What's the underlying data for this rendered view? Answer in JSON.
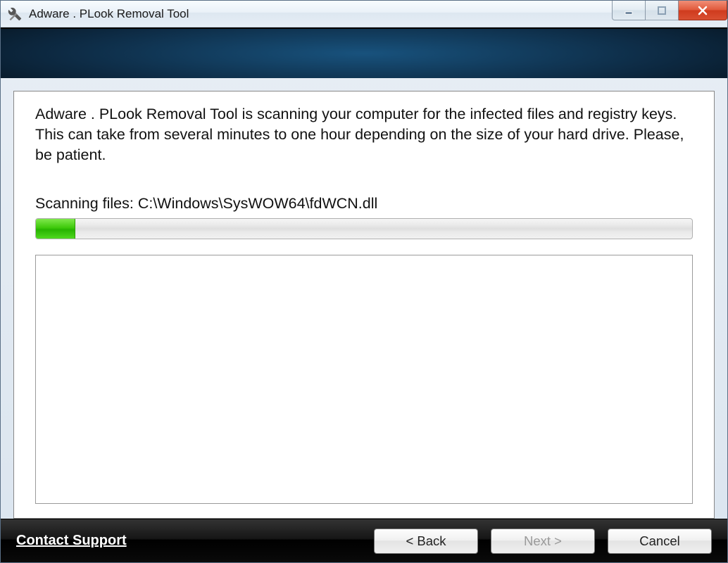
{
  "window": {
    "title": "Adware . PLook Removal Tool"
  },
  "main": {
    "description": "Adware . PLook Removal Tool is scanning your computer for the infected files and registry keys. This can take from several minutes to one hour depending on the size of your hard drive. Please, be patient.",
    "scan_label": "Scanning files:",
    "scan_path": "C:\\Windows\\SysWOW64\\fdWCN.dll",
    "progress_percent": 6
  },
  "footer": {
    "support_label": "Contact Support",
    "back_label": "< Back",
    "next_label": "Next >",
    "cancel_label": "Cancel"
  }
}
